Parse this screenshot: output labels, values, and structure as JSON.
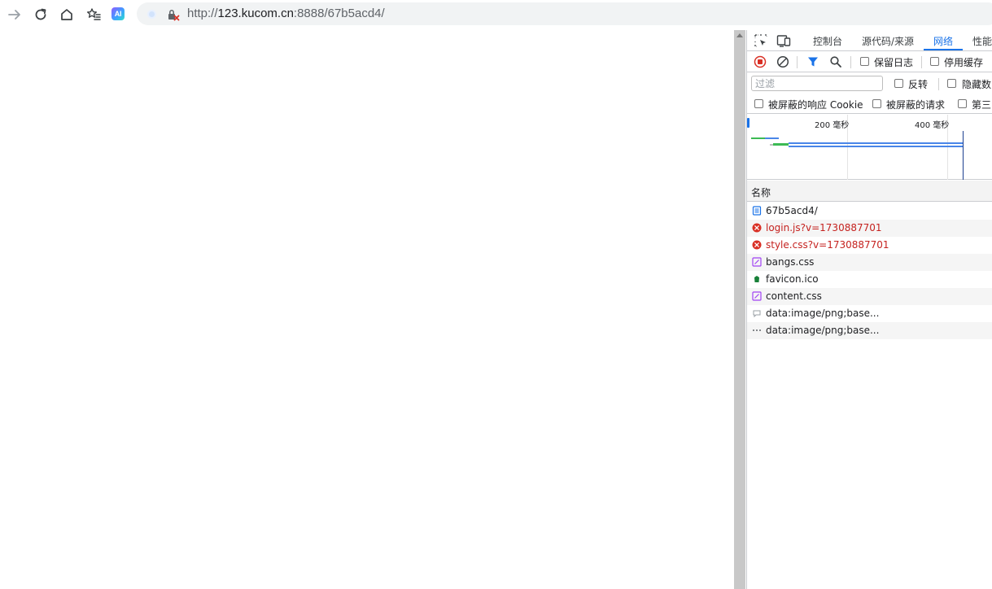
{
  "browser": {
    "url_scheme": "http://",
    "url_host": "123.kucom.cn",
    "url_rest": ":8888/67b5acd4/",
    "ai_badge": "AI"
  },
  "devtools": {
    "tabs": [
      {
        "label": "控制台",
        "active": false
      },
      {
        "label": "源代码/来源",
        "active": false
      },
      {
        "label": "网络",
        "active": true
      },
      {
        "label": "性能",
        "active": false
      }
    ],
    "toolbar": {
      "preserve_log": "保留日志",
      "disable_cache": "停用缓存"
    },
    "filter": {
      "placeholder": "过滤",
      "invert": "反转",
      "hide_data": "隐藏数"
    },
    "filters_row": {
      "blocked_cookies": "被屏蔽的响应 Cookie",
      "blocked_requests": "被屏蔽的请求",
      "third_party": "第三"
    },
    "overview": {
      "tick_200": "200 毫秒",
      "tick_400": "400 毫秒"
    },
    "list": {
      "name_header": "名称",
      "requests": [
        {
          "name": "67b5acd4/",
          "type": "document",
          "error": false
        },
        {
          "name": "login.js?v=1730887701",
          "type": "error",
          "error": true
        },
        {
          "name": "style.css?v=1730887701",
          "type": "error",
          "error": true
        },
        {
          "name": "bangs.css",
          "type": "stylesheet",
          "error": false
        },
        {
          "name": "favicon.ico",
          "type": "image",
          "error": false
        },
        {
          "name": "content.css",
          "type": "stylesheet",
          "error": false
        },
        {
          "name": "data:image/png;base...",
          "type": "data-image",
          "error": false
        },
        {
          "name": "data:image/png;base...",
          "type": "data-image",
          "error": false
        }
      ]
    }
  },
  "colors": {
    "accent": "#1a73e8",
    "error": "#c5221f",
    "waterfall_green": "#3cba54",
    "waterfall_blue": "#4a86e8"
  }
}
